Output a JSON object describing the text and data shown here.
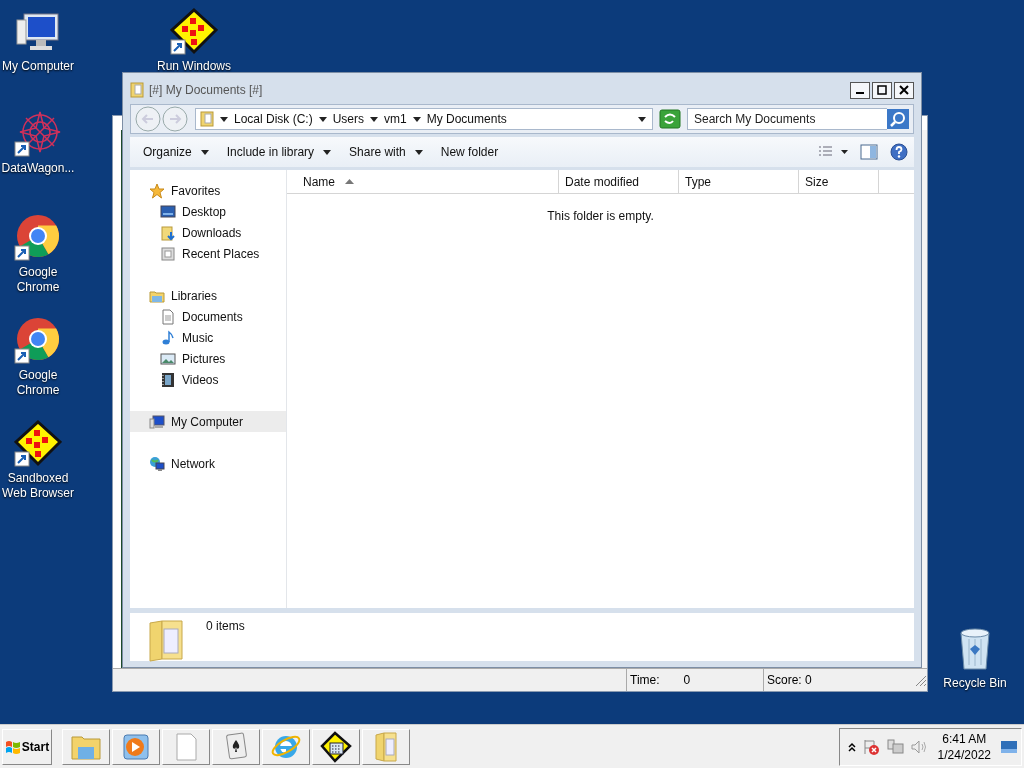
{
  "desktop_icons": [
    {
      "label": "My Computer",
      "kind": "computer",
      "shortcut": false
    },
    {
      "label": "Run Windows",
      "kind": "diamond",
      "shortcut": true
    },
    {
      "label": "DataWagon...",
      "kind": "starburst",
      "shortcut": true
    },
    {
      "label": "Google Chrome",
      "kind": "browser",
      "shortcut": true
    },
    {
      "label": "Google Chrome",
      "kind": "browser",
      "shortcut": true
    },
    {
      "label": "Sandboxed Web Browser",
      "kind": "diamond",
      "shortcut": true
    },
    {
      "label": "Recycle Bin",
      "kind": "bin",
      "shortcut": false
    }
  ],
  "back_window": {
    "status": [
      "Time:",
      "0",
      "Score: 0"
    ]
  },
  "explorer": {
    "title": "[#] My Documents [#]",
    "breadcrumb": [
      "Local Disk (C:)",
      "Users",
      "vm1",
      "My Documents"
    ],
    "search": {
      "placeholder": "Search My Documents"
    },
    "toolbar": [
      {
        "label": "Organize",
        "dropdown": true
      },
      {
        "label": "Include in library",
        "dropdown": true
      },
      {
        "label": "Share with",
        "dropdown": true
      },
      {
        "label": "New folder",
        "dropdown": false
      }
    ],
    "nav": [
      {
        "label": "Favorites",
        "kind": "star",
        "selected": false,
        "children": [
          {
            "label": "Desktop",
            "kind": "desktop",
            "selected": false
          },
          {
            "label": "Downloads",
            "kind": "downloads",
            "selected": false
          },
          {
            "label": "Recent Places",
            "kind": "recent",
            "selected": false
          }
        ]
      },
      {
        "label": "Libraries",
        "kind": "library",
        "selected": false,
        "children": [
          {
            "label": "Documents",
            "kind": "document",
            "selected": false
          },
          {
            "label": "Music",
            "kind": "music",
            "selected": false
          },
          {
            "label": "Pictures",
            "kind": "pictures",
            "selected": false
          },
          {
            "label": "Videos",
            "kind": "videos",
            "selected": false
          }
        ]
      },
      {
        "label": "My Computer",
        "kind": "computer",
        "selected": true
      },
      {
        "label": "Network",
        "kind": "network",
        "selected": false
      }
    ],
    "columns": [
      {
        "label": "Name",
        "sorted": true
      },
      {
        "label": "Date modified",
        "sorted": false
      },
      {
        "label": "Type",
        "sorted": false
      },
      {
        "label": "Size",
        "sorted": false
      }
    ],
    "empty_message": "This folder is empty.",
    "details": "0 items"
  },
  "taskbar": {
    "start": "Start",
    "buttons": [
      {
        "kind": "explorer"
      },
      {
        "kind": "media"
      },
      {
        "kind": "page"
      },
      {
        "kind": "cards"
      },
      {
        "kind": "ie"
      },
      {
        "kind": "calc"
      },
      {
        "kind": "folder"
      }
    ],
    "time": "6:41 AM",
    "date": "1/24/2022"
  }
}
